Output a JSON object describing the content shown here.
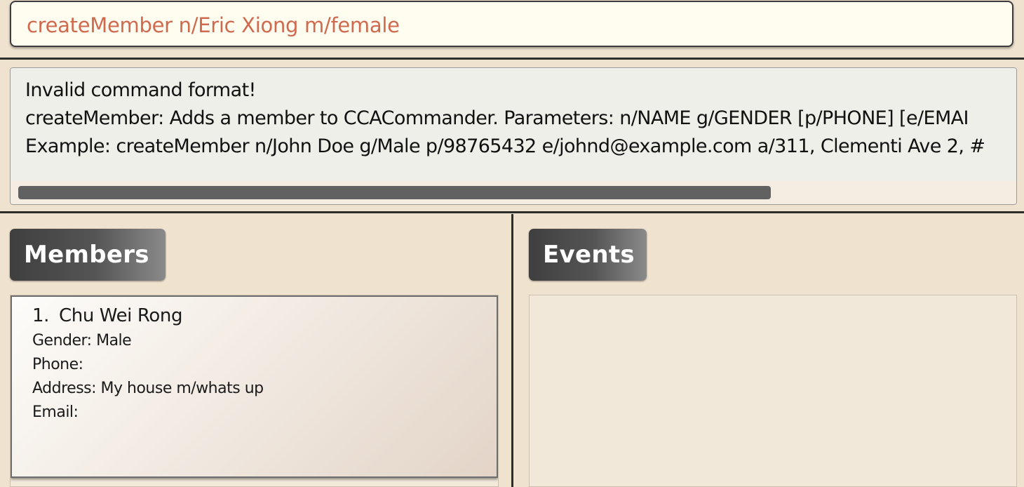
{
  "command_box": {
    "value": "createMember n/Eric Xiong m/female"
  },
  "result_display": {
    "lines": [
      "Invalid command format!",
      "createMember: Adds a member to CCACommander. Parameters: n/NAME g/GENDER [p/PHONE] [e/EMAI",
      "Example: createMember n/John Doe g/Male p/98765432 e/johnd@example.com a/311, Clementi Ave 2, #"
    ],
    "scroll_fraction_visible": 0.76
  },
  "members_panel": {
    "title": "Members",
    "members": [
      {
        "index": "1.",
        "name": "Chu Wei Rong",
        "gender": "Gender: Male",
        "phone": "Phone:",
        "address": "Address: My house m/whats up",
        "email": "Email:"
      }
    ]
  },
  "events_panel": {
    "title": "Events"
  },
  "colors": {
    "background": "#efe2cf",
    "command_text": "#cf6a4f",
    "title_dark": "#3f3f3f",
    "scroll_thumb": "#616161"
  }
}
